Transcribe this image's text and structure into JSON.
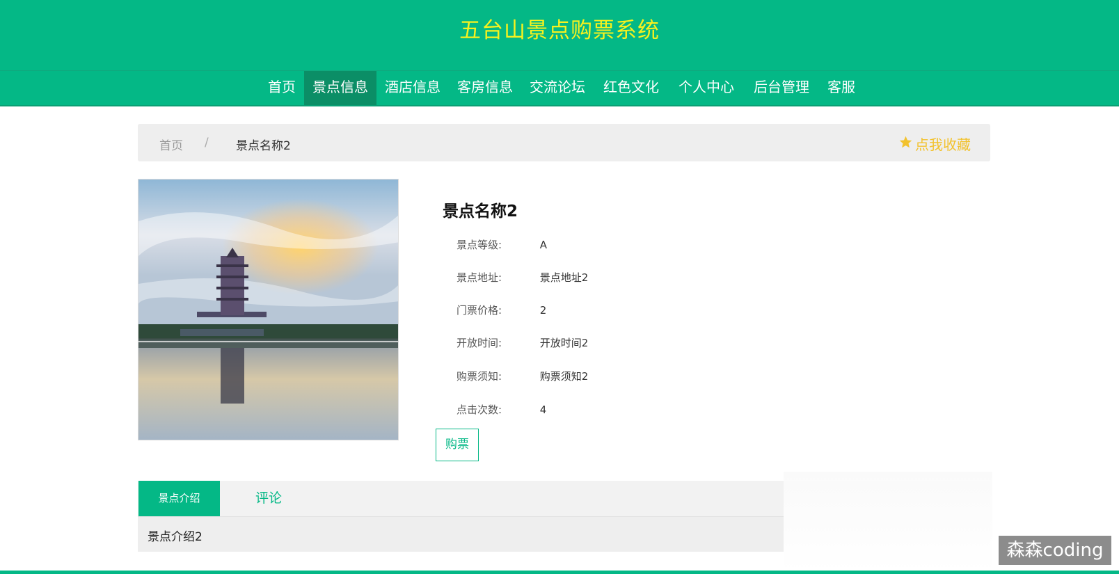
{
  "header": {
    "title": "五台山景点购票系统"
  },
  "nav": {
    "items": [
      {
        "label": "首页"
      },
      {
        "label": "景点信息"
      },
      {
        "label": "酒店信息"
      },
      {
        "label": "客房信息"
      },
      {
        "label": "交流论坛"
      },
      {
        "label": "红色文化"
      },
      {
        "label": "个人中心"
      },
      {
        "label": "后台管理"
      },
      {
        "label": "客服"
      }
    ],
    "active_index": 1
  },
  "breadcrumb": {
    "home": "首页",
    "separator": "/",
    "current": "景点名称2"
  },
  "favorite": {
    "label": "点我收藏",
    "icon": "star-icon",
    "color": "#f2c22e"
  },
  "detail": {
    "name": "景点名称2",
    "fields": [
      {
        "label": "景点等级:",
        "value": "A"
      },
      {
        "label": "景点地址:",
        "value": "景点地址2"
      },
      {
        "label": "门票价格:",
        "value": "2"
      },
      {
        "label": "开放时间:",
        "value": "开放时间2"
      },
      {
        "label": "购票须知:",
        "value": "购票须知2"
      },
      {
        "label": "点击次数:",
        "value": "4"
      }
    ],
    "buy_label": "购票"
  },
  "tabs": {
    "items": [
      {
        "label": "景点介绍"
      },
      {
        "label": "评论"
      }
    ],
    "active_index": 0,
    "content": "景点介绍2"
  },
  "watermark": "森森coding",
  "colors": {
    "primary": "#04b886",
    "title": "#f7f21e",
    "nav_active": "#0b8e66"
  }
}
